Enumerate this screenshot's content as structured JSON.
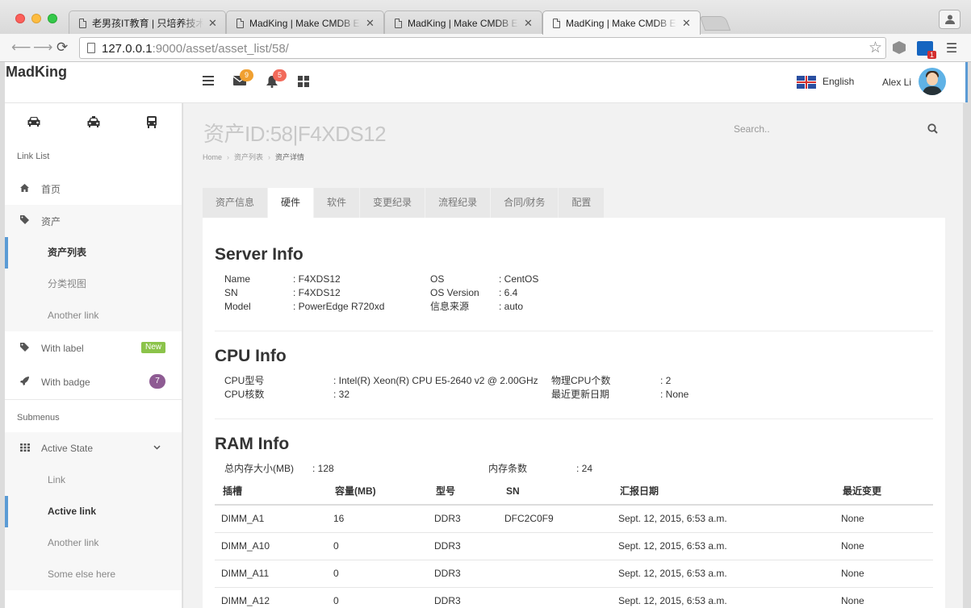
{
  "browser": {
    "tabs": [
      {
        "title": "老男孩IT教育 | 只培养技术精英"
      },
      {
        "title": "MadKing | Make CMDB Easy"
      },
      {
        "title": "MadKing | Make CMDB Easy"
      },
      {
        "title": "MadKing | Make CMDB Easy"
      }
    ],
    "url_host": "127.0.0.1",
    "url_rest": ":9000/asset/asset_list/58/",
    "ext_badge": "1"
  },
  "header": {
    "brand": "MadKing",
    "mail_count": "9",
    "notify_count": "5",
    "language": "English",
    "user": "Alex Li"
  },
  "sidebar": {
    "heading_links": "Link List",
    "home": "首页",
    "asset": "资产",
    "asset_list": "资产列表",
    "category_view": "分类视图",
    "another_link": "Another link",
    "with_label": "With label",
    "label_new": "New",
    "with_badge": "With badge",
    "badge_count": "7",
    "heading_sub": "Submenus",
    "active_state": "Active State",
    "link": "Link",
    "active_link": "Active link",
    "another_link_2": "Another link",
    "some_else": "Some else here"
  },
  "main": {
    "title": "资产ID:58|F4XDS12",
    "search_placeholder": "Search..",
    "breadcrumb": [
      "Home",
      "资产列表",
      "资产详情"
    ],
    "tabs": [
      "资产信息",
      "硬件",
      "软件",
      "变更纪录",
      "流程纪录",
      "合同/财务",
      "配置"
    ],
    "active_tab": 1
  },
  "server_info": {
    "title": "Server Info",
    "name_label": "Name",
    "name_value": ": F4XDS12",
    "sn_label": "SN",
    "sn_value": ": F4XDS12",
    "model_label": "Model",
    "model_value": ": PowerEdge R720xd",
    "os_label": "OS",
    "os_value": ": CentOS",
    "osver_label": "OS Version",
    "osver_value": ": 6.4",
    "source_label": "信息来源",
    "source_value": ": auto"
  },
  "cpu_info": {
    "title": "CPU Info",
    "model_label": "CPU型号",
    "model_value": ": Intel(R) Xeon(R) CPU E5-2640 v2 @ 2.00GHz",
    "cores_label": "CPU核数",
    "cores_value": ": 32",
    "phys_label": "物理CPU个数",
    "phys_value": ": 2",
    "updated_label": "最近更新日期",
    "updated_value": ": None"
  },
  "ram_info": {
    "title": "RAM Info",
    "total_label": "总内存大小(MB)",
    "total_value": ": 128",
    "count_label": "内存条数",
    "count_value": ": 24",
    "columns": [
      "插槽",
      "容量(MB)",
      "型号",
      "SN",
      "汇报日期",
      "最近变更"
    ],
    "rows": [
      [
        "DIMM_A1",
        "16",
        "DDR3",
        "DFC2C0F9",
        "Sept. 12, 2015, 6:53 a.m.",
        "None"
      ],
      [
        "DIMM_A10",
        "0",
        "DDR3",
        "",
        "Sept. 12, 2015, 6:53 a.m.",
        "None"
      ],
      [
        "DIMM_A11",
        "0",
        "DDR3",
        "",
        "Sept. 12, 2015, 6:53 a.m.",
        "None"
      ],
      [
        "DIMM_A12",
        "0",
        "DDR3",
        "",
        "Sept. 12, 2015, 6:53 a.m.",
        "None"
      ]
    ]
  }
}
